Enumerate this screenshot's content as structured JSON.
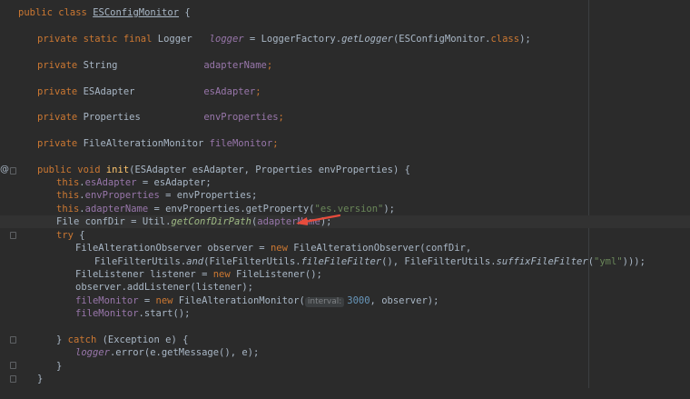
{
  "code_lines": {
    "l1": {
      "kw": "public class ",
      "name": "ESConfigMonitor",
      "rest": " {"
    },
    "l2": {
      "kw": "private static final ",
      "type": "Logger   ",
      "field": "logger",
      "rest1": " = LoggerFactory.",
      "smethod": "getLogger",
      "rest2": "(ESConfigMonitor.",
      "kw2": "class",
      "rest3": ");"
    },
    "l3": {
      "kw": "private ",
      "type": "String               ",
      "field": "adapterName",
      "rest": ";"
    },
    "l4": {
      "kw": "private ",
      "type": "ESAdapter            ",
      "field": "esAdapter",
      "rest": ";"
    },
    "l5": {
      "kw": "private ",
      "type": "Properties           ",
      "field": "envProperties",
      "rest": ";"
    },
    "l6": {
      "kw": "private ",
      "type": "FileAlterationMonitor ",
      "field": "fileMonitor",
      "rest": ";"
    },
    "l7": {
      "kw": "public void ",
      "fn": "init",
      "rest": "(ESAdapter esAdapter, Properties envProperties) {"
    },
    "l8": {
      "kw": "this",
      "dot": ".",
      "field": "esAdapter",
      "rest": " = esAdapter;"
    },
    "l9": {
      "kw": "this",
      "dot": ".",
      "field": "envProperties",
      "rest": " = envProperties;"
    },
    "l10": {
      "kw": "this",
      "dot": ".",
      "field": "adapterName",
      "rest1": " = envProperties.getProperty(",
      "str": "\"es.version\"",
      "rest2": ");"
    },
    "l11": {
      "rest1": "File confDir = Util.",
      "smethod": "getConfDirPath",
      "rest2": "(",
      "field": "adapterName",
      "rest3": ");"
    },
    "l12": {
      "kw": "try",
      "rest": " {"
    },
    "l13": {
      "rest1": "FileAlterationObserver observer = ",
      "kw": "new",
      "rest2": " FileAlterationObserver(confDir,"
    },
    "l14": {
      "rest1": "FileFilterUtils.",
      "sm1": "and",
      "rest2": "(FileFilterUtils.",
      "sm2": "fileFileFilter",
      "rest3": "(), FileFilterUtils.",
      "sm3": "suffixFileFilter",
      "rest4": "(",
      "str": "\"yml\"",
      "rest5": ")));"
    },
    "l15": {
      "rest1": "FileListener listener = ",
      "kw": "new",
      "rest2": " FileListener();"
    },
    "l16": {
      "rest": "observer.addListener(listener);"
    },
    "l17": {
      "field": "fileMonitor",
      "rest1": " = ",
      "kw": "new",
      "rest2": " FileAlterationMonitor(",
      "hint": "interval:",
      "num": "3000",
      "rest3": ", observer);"
    },
    "l18": {
      "field": "fileMonitor",
      "rest": ".start();"
    },
    "l19": {
      "rest1": "} ",
      "kw": "catch",
      "rest2": " (Exception e) {"
    },
    "l20": {
      "sfield": "logger",
      "rest": ".error(e.getMessage(), e);"
    },
    "l21": {
      "rest": "}"
    },
    "l22": {
      "rest": "}"
    }
  },
  "gutter": {
    "override_icon": "@"
  },
  "colors": {
    "background": "#2b2b2b",
    "keyword": "#cc7832",
    "field": "#9876aa",
    "string": "#6a8759",
    "number": "#6897bb",
    "function": "#ffc66d",
    "arrow": "#e74c3c"
  }
}
